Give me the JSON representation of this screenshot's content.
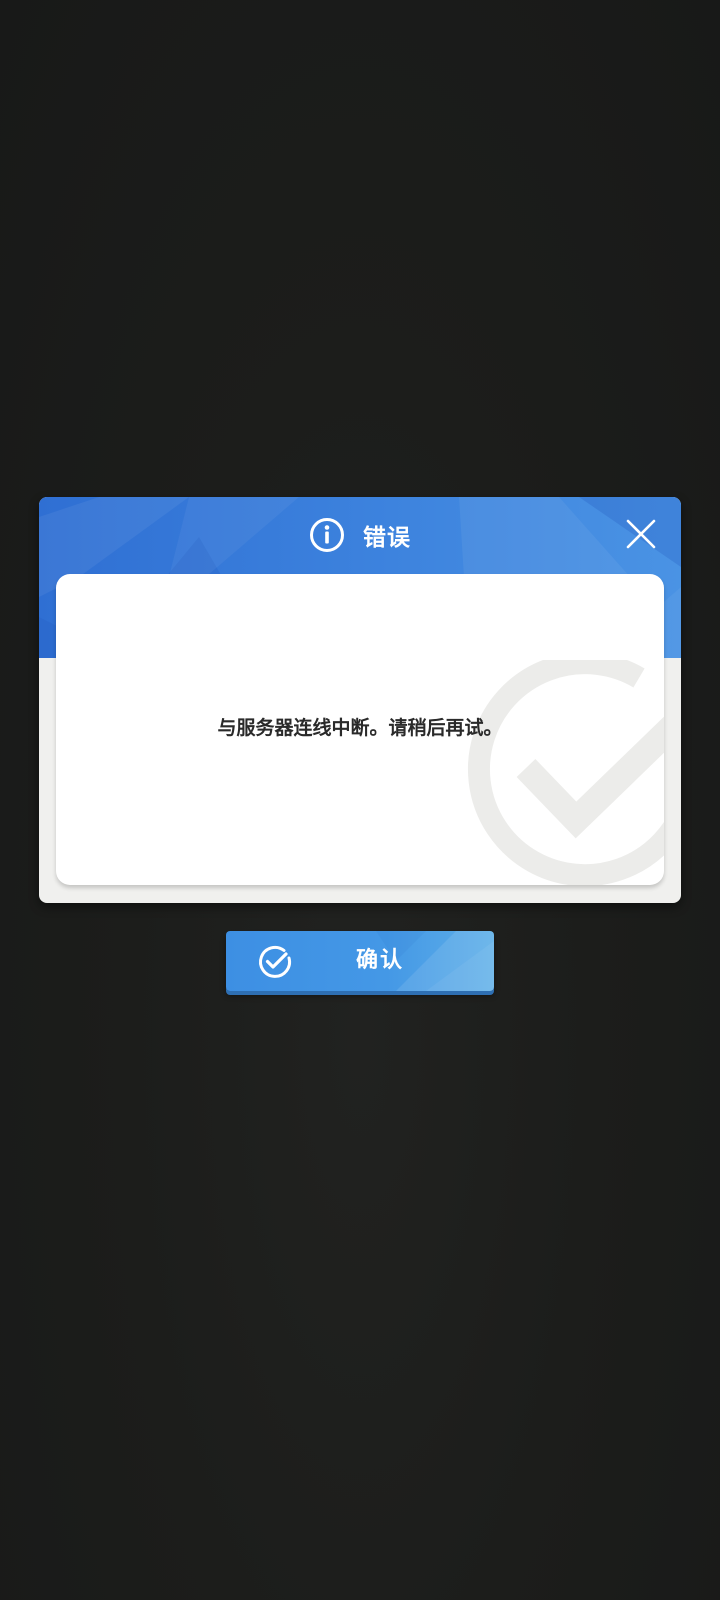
{
  "dialog": {
    "title": "错误",
    "title_icon": "info-icon",
    "close_icon": "close-icon",
    "message": "与服务器连线中断。请稍后再试。",
    "watermark_icon": "check-circle-icon"
  },
  "confirm_button": {
    "label": "确认",
    "icon": "check-circle-icon"
  },
  "colors": {
    "background": "#1c1d1b",
    "header_blue": "#3d83de",
    "button_blue": "#4498e6",
    "body_white": "#ffffff",
    "message_text": "#2a2a2a"
  }
}
